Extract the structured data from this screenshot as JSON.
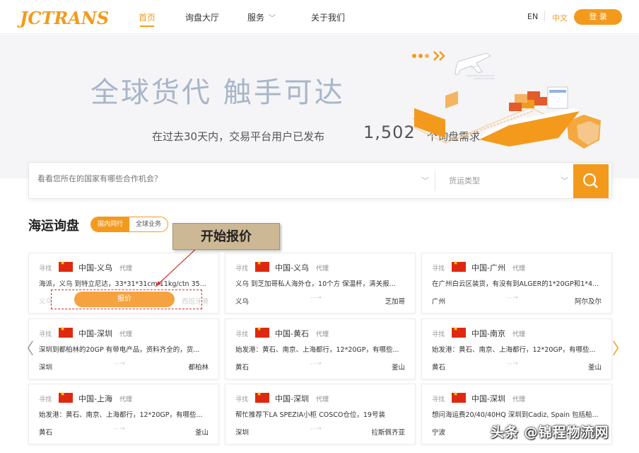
{
  "header": {
    "logo_text": "JCTRANS",
    "nav": [
      "首页",
      "询盘大厅",
      "服务",
      "关于我们"
    ],
    "lang_en": "EN",
    "lang_zh": "中文",
    "login_label": "登 录"
  },
  "hero": {
    "title": "全球货代 触手可达",
    "sub_prefix": "在过去30天内，交易平台用户已发布",
    "count": "1,502",
    "sub_suffix": "个询盘需求"
  },
  "search": {
    "placeholder": "看看您所在的国家有哪些合作机会？",
    "type_placeholder": "货运类型"
  },
  "section": {
    "title": "海运询盘",
    "tab_domestic": "国内同行",
    "tab_global": "全球业务"
  },
  "callout": "开始报价",
  "cards": [
    {
      "find": "寻找",
      "route": "中国-义乌",
      "agent": "代理",
      "desc": "海派，义乌 到特立尼达，33*31*31cm 11kg/ctn 35...",
      "from": "义乌",
      "to": "西班牙港",
      "quote": "报价"
    },
    {
      "find": "寻找",
      "route": "中国-义乌",
      "agent": "代理",
      "desc": "义乌 到芝加哥私人海外仓，10个方 保温杯，清关报...",
      "from": "义乌",
      "to": "芝加哥"
    },
    {
      "find": "寻找",
      "route": "中国-广州",
      "agent": "代理",
      "desc": "在广州白云区装货，有没有到ALGER的1*20GP和1*4...",
      "from": "广州",
      "to": "阿尔及尔"
    },
    {
      "find": "寻找",
      "route": "中国-深圳",
      "agent": "代理",
      "desc": "深圳到都柏林的20GP 有带电产品，资料齐全的，货...",
      "from": "深圳",
      "to": "都柏林"
    },
    {
      "find": "寻找",
      "route": "中国-黄石",
      "agent": "代理",
      "desc": "始发港：黄石、南京、上海都行，12*20GP，有哪些...",
      "from": "黄石",
      "to": "釜山"
    },
    {
      "find": "寻找",
      "route": "中国-南京",
      "agent": "代理",
      "desc": "始发港：黄石、南京、上海都行，12*20GP，有哪些...",
      "from": "黄石",
      "to": "釜山"
    },
    {
      "find": "寻找",
      "route": "中国-上海",
      "agent": "代理",
      "desc": "始发港：黄石、南京、上海都行，12*20GP，有哪些...",
      "from": "黄石",
      "to": "釜山"
    },
    {
      "find": "寻找",
      "route": "中国-深圳",
      "agent": "代理",
      "desc": "帮忙推荐下LA SPEZIA小柜 COSCO仓位，19号装",
      "from": "深圳",
      "to": "拉斯佩齐亚"
    },
    {
      "find": "寻找",
      "route": "中国-深圳",
      "agent": "代理",
      "desc": "想问海运费20/40/40HQ 深圳到Cadiz, Spain 包括船...",
      "from": "宁波",
      "to": "加的斯"
    }
  ],
  "watermark": "头条 @锦程物流网",
  "colors": {
    "accent": "#f39a1d",
    "flag_red": "#de2910",
    "callout_bg": "#cdb895",
    "dashed_red": "#d9302a"
  }
}
